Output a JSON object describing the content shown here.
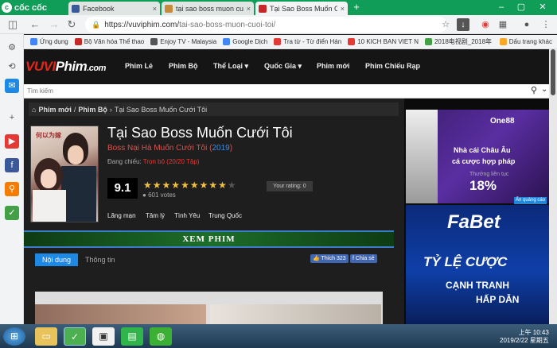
{
  "browser": {
    "brand": "cốc cốc",
    "tabs": [
      {
        "label": "Facebook",
        "color": "#3b5998"
      },
      {
        "label": "tại sao boss muon cuoi",
        "color": "#c58a3a"
      },
      {
        "label": "Tại Sao Boss Muốn Cưới",
        "color": "#c62828"
      }
    ],
    "new_tab": "+",
    "url_host": "https://vuviphim.com/",
    "url_path": "tai-sao-boss-muon-cuoi-toi/",
    "bookmarks": [
      {
        "label": "Ứng dụng",
        "color": "#4285f4"
      },
      {
        "label": "Bộ Văn hóa Thể thao",
        "color": "#c62828"
      },
      {
        "label": "Enjoy TV - Malaysia",
        "color": "#555"
      },
      {
        "label": "Google Dịch",
        "color": "#4285f4"
      },
      {
        "label": "Tra từ - Từ điển Hán",
        "color": "#e53935"
      },
      {
        "label": "10 KICH BAN VIET N",
        "color": "#e53935"
      },
      {
        "label": "2018电视剧_2018年",
        "color": "#43a047"
      },
      {
        "label": "Dấu trang khác",
        "color": "#f9a825"
      }
    ]
  },
  "site": {
    "logo_v": "VUVI",
    "logo_p": "Phim",
    "logo_c": ".com",
    "menu": [
      "Phim Lẻ",
      "Phim Bộ",
      "Thể Loại ▾",
      "Quốc Gia ▾",
      "Phim mới",
      "Phim Chiếu Rạp"
    ],
    "search_placeholder": "Tìm kiếm"
  },
  "breadcrumb": {
    "home": "Phim mới",
    "sep1": "/",
    "cat": "Phim Bộ",
    "sep2": "›",
    "current": "Tại Sao Boss Muốn Cưới Tôi"
  },
  "movie": {
    "title": "Tại Sao Boss Muốn Cưới Tôi",
    "original": "Boss Nại Hà Muốn Cưới Tôi",
    "year": "2019",
    "status_label": "Đang chiếu:",
    "status_value": "Trọn bộ (20/20 Tập)",
    "rating": "9.1",
    "stars_filled": 9,
    "stars_total": 10,
    "votes": "601 votes",
    "your_rating": "Your rating: 0",
    "tags": [
      "Lãng mạn",
      "Tâm lý",
      "Tình Yêu",
      "Trung Quốc"
    ],
    "watch": "XEM PHIM",
    "tab_content": "Nội dung",
    "tab_info": "Thông tin",
    "like": "Thích 323",
    "share": "Chia sẻ",
    "poster_text": "何以为嫁"
  },
  "ads": {
    "ad1_brand": "One88",
    "ad1_l1": "Nhà cái Châu Âu",
    "ad1_l2": "cá cược hợp pháp",
    "ad1_l3": "Thưởng liên tục",
    "ad1_l4": "18%",
    "label": "Ẩn quảng cáo",
    "ad2_brand": "FaBet",
    "ad2_l1": "TỶ LỆ CƯỢC",
    "ad2_l2": "CẠNH TRANH",
    "ad2_l3": "HẤP DẪN"
  },
  "taskbar": {
    "time": "上午 10:43",
    "date": "2019/2/22 星期五"
  }
}
